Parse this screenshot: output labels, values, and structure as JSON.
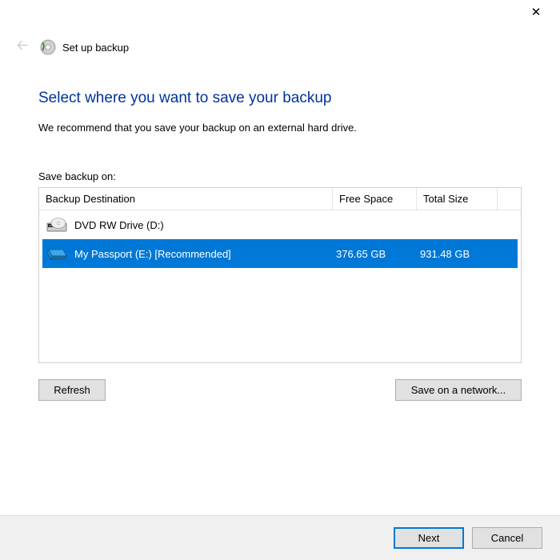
{
  "titlebar": {
    "close_tooltip": "Close"
  },
  "header": {
    "window_title": "Set up backup"
  },
  "main": {
    "heading": "Select where you want to save your backup",
    "recommendation": "We recommend that you save your backup on an external hard drive.",
    "table_label": "Save backup on:",
    "columns": {
      "destination": "Backup Destination",
      "free": "Free Space",
      "total": "Total Size"
    },
    "rows": [
      {
        "icon": "dvd",
        "name": "DVD RW Drive (D:)",
        "free": "",
        "total": "",
        "selected": false
      },
      {
        "icon": "hd",
        "name": "My Passport (E:) [Recommended]",
        "free": "376.65 GB",
        "total": "931.48 GB",
        "selected": true
      }
    ],
    "refresh_label": "Refresh",
    "network_label": "Save on a network..."
  },
  "footer": {
    "next_label": "Next",
    "cancel_label": "Cancel"
  }
}
